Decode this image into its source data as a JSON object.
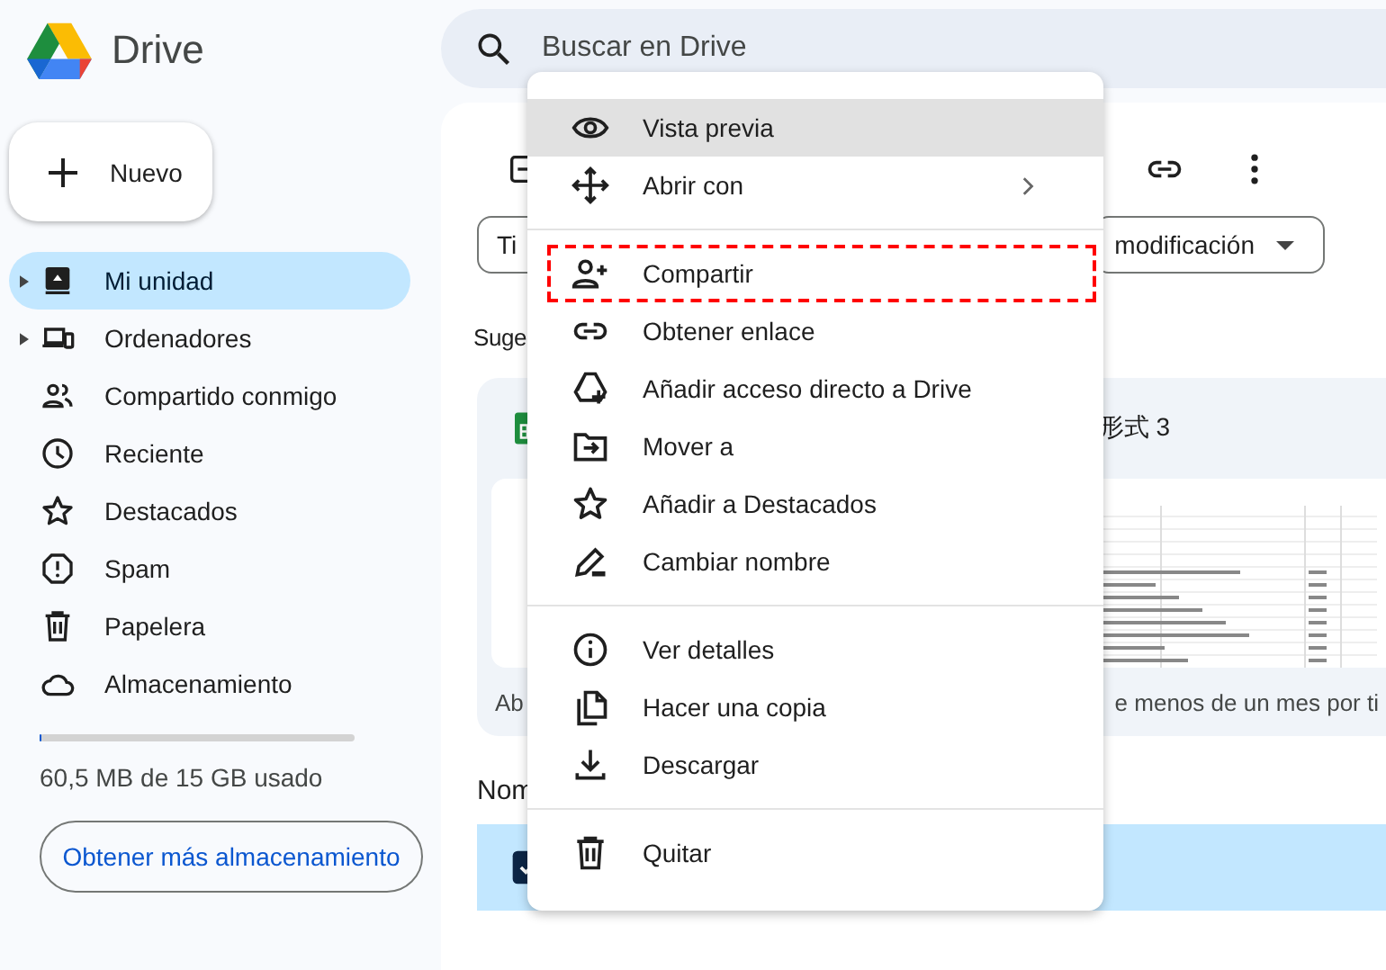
{
  "app": {
    "name": "Drive"
  },
  "search": {
    "placeholder": "Buscar en Drive"
  },
  "new_button": {
    "label": "Nuevo"
  },
  "sidebar": {
    "items": [
      {
        "label": "Mi unidad",
        "expandable": true,
        "selected": true
      },
      {
        "label": "Ordenadores",
        "expandable": true,
        "selected": false
      },
      {
        "label": "Compartido conmigo",
        "expandable": false,
        "selected": false
      },
      {
        "label": "Reciente",
        "expandable": false,
        "selected": false
      },
      {
        "label": "Destacados",
        "expandable": false,
        "selected": false
      },
      {
        "label": "Spam",
        "expandable": false,
        "selected": false
      },
      {
        "label": "Papelera",
        "expandable": false,
        "selected": false
      },
      {
        "label": "Almacenamiento",
        "expandable": false,
        "selected": false
      }
    ]
  },
  "storage": {
    "level": 0.004,
    "usage": "60,5 MB de 15 GB usado",
    "button": "Obtener más almacenamiento"
  },
  "filters": [
    {
      "label": "Ti",
      "dropdown": false
    },
    {
      "label": "modificación",
      "dropdown": true
    }
  ],
  "suggestions": {
    "heading": "Suge",
    "card": {
      "title": "形式 3",
      "caption_start": "Ab",
      "caption_end": "e menos de un mes por ti"
    }
  },
  "list": {
    "header": "Nom",
    "row": {
      "selected": true
    }
  },
  "context_menu": {
    "groups": [
      [
        {
          "label": "Vista previa",
          "highlighted": true,
          "submenu": false,
          "annotated": false
        },
        {
          "label": "Abrir con",
          "highlighted": false,
          "submenu": true,
          "annotated": false
        }
      ],
      [
        {
          "label": "Compartir",
          "highlighted": false,
          "submenu": false,
          "annotated": true
        },
        {
          "label": "Obtener enlace",
          "highlighted": false,
          "submenu": false,
          "annotated": false
        },
        {
          "label": "Añadir acceso directo a Drive",
          "highlighted": false,
          "submenu": false,
          "annotated": false
        },
        {
          "label": "Mover a",
          "highlighted": false,
          "submenu": false,
          "annotated": false
        },
        {
          "label": "Añadir a Destacados",
          "highlighted": false,
          "submenu": false,
          "annotated": false
        },
        {
          "label": "Cambiar nombre",
          "highlighted": false,
          "submenu": false,
          "annotated": false
        }
      ],
      [
        {
          "label": "Ver detalles",
          "highlighted": false,
          "submenu": false,
          "annotated": false
        },
        {
          "label": "Hacer una copia",
          "highlighted": false,
          "submenu": false,
          "annotated": false
        },
        {
          "label": "Descargar",
          "highlighted": false,
          "submenu": false,
          "annotated": false
        }
      ],
      [
        {
          "label": "Quitar",
          "highlighted": false,
          "submenu": false,
          "annotated": false
        }
      ]
    ]
  }
}
